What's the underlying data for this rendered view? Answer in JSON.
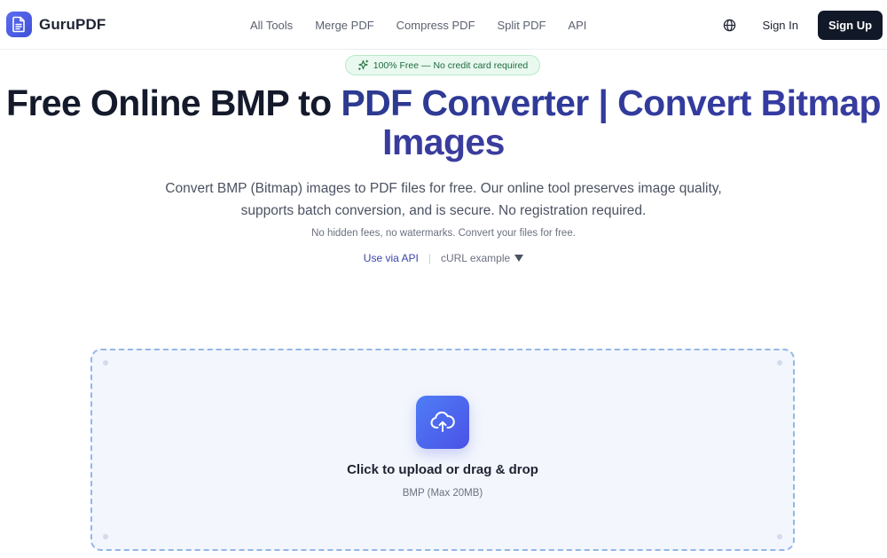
{
  "brand": {
    "name": "GuruPDF"
  },
  "nav": {
    "items": [
      {
        "label": "All Tools"
      },
      {
        "label": "Merge PDF"
      },
      {
        "label": "Compress PDF"
      },
      {
        "label": "Split PDF"
      },
      {
        "label": "API"
      }
    ]
  },
  "header_right": {
    "language_icon": "globe-icon",
    "sign_in_label": "Sign In",
    "sign_up_label": "Sign Up"
  },
  "hero": {
    "badge_icon": "sparkles-icon",
    "badge_text": "100% Free — No credit card required",
    "title_part1": "Free Online BMP to ",
    "title_part2": "PDF Converter | Convert Bitmap Images",
    "description": "Convert BMP (Bitmap) images to PDF files for free. Our online tool preserves image quality, supports batch conversion, and is secure. No registration required.",
    "note": "No hidden fees, no watermarks. Convert your files for free.",
    "api_link_label": "Use via API",
    "separator": "|",
    "curl_label": "cURL example"
  },
  "dropzone": {
    "icon": "cloud-upload-icon",
    "title": "Click to upload or drag & drop",
    "subtitle": "BMP (Max 20MB)"
  },
  "colors": {
    "brand_accent": "#4a52e6",
    "title_gradient": "#2c3a90",
    "signup_bg": "#111827",
    "badge_bg": "#e9f9ef",
    "dropzone_border": "#94b6e8"
  }
}
